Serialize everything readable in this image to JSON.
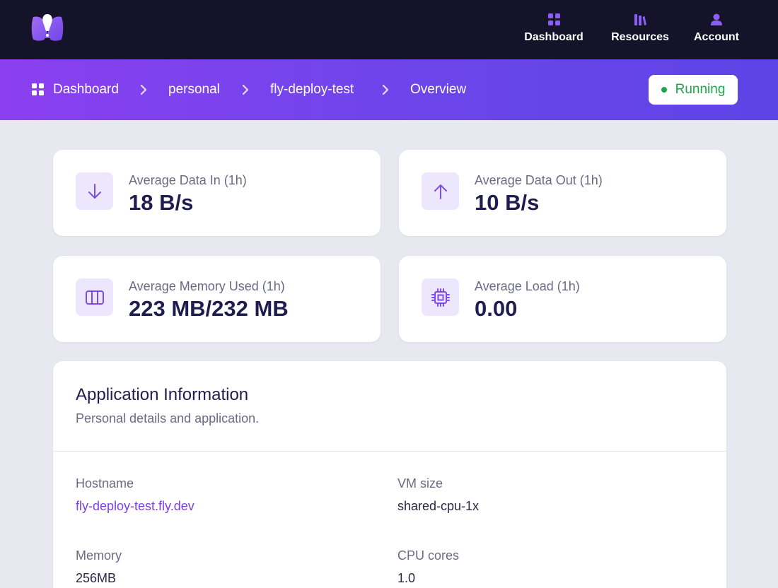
{
  "nav": {
    "items": [
      {
        "label": "Dashboard",
        "icon": "grid-icon"
      },
      {
        "label": "Resources",
        "icon": "books-icon"
      },
      {
        "label": "Account",
        "icon": "user-icon"
      }
    ]
  },
  "breadcrumb": {
    "items": [
      "Dashboard",
      "personal",
      "fly-deploy-test",
      "Overview"
    ]
  },
  "status": {
    "label": "Running",
    "color": "#21a34a"
  },
  "stats": [
    {
      "label": "Average Data In (1h)",
      "value": "18 B/s",
      "icon": "arrow-down-icon"
    },
    {
      "label": "Average Data Out (1h)",
      "value": "10 B/s",
      "icon": "arrow-up-icon"
    },
    {
      "label": "Average Memory Used (1h)",
      "value": "223 MB/232 MB",
      "icon": "memory-icon"
    },
    {
      "label": "Average Load (1h)",
      "value": "0.00",
      "icon": "cpu-icon"
    }
  ],
  "info": {
    "title": "Application Information",
    "subtitle": "Personal details and application.",
    "fields": [
      {
        "label": "Hostname",
        "value": "fly-deploy-test.fly.dev"
      },
      {
        "label": "VM size",
        "value": "shared-cpu-1x"
      },
      {
        "label": "Memory",
        "value": "256MB"
      },
      {
        "label": "CPU cores",
        "value": "1.0"
      }
    ]
  },
  "colors": {
    "accent": "#7b3fe4",
    "nav_bg": "#14132a",
    "page_bg": "#e8e8f1"
  }
}
